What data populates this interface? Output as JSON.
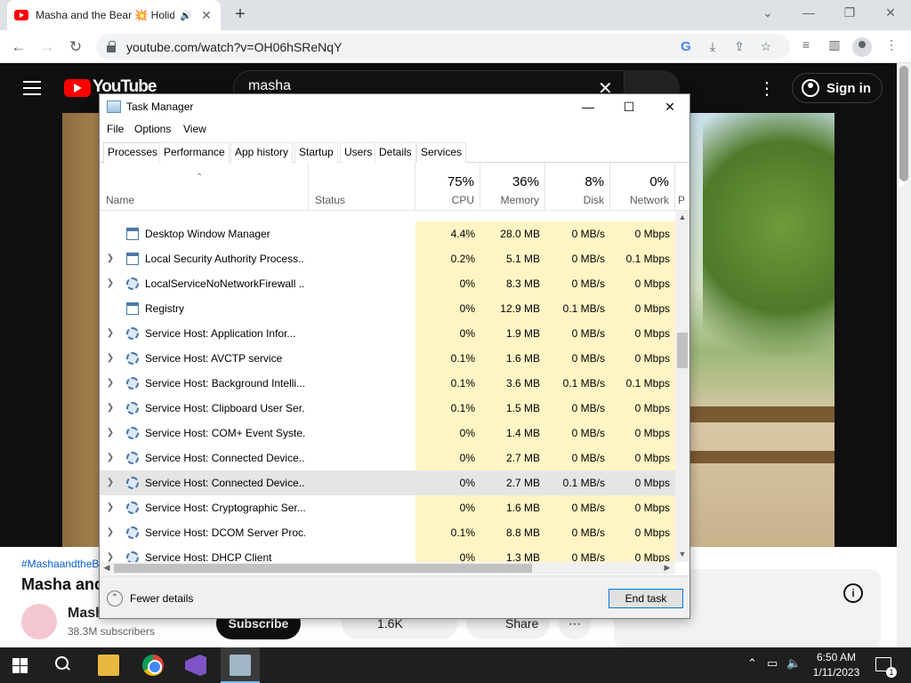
{
  "browser": {
    "tab_title": "Masha and the Bear 💥 Holiday on Ice",
    "url": "youtube.com/watch?v=OH06hSReNqY"
  },
  "youtube": {
    "logo_text": "YouTube",
    "search_value": "masha",
    "sign_in": "Sign in",
    "hashtag": "#MashaandtheBear",
    "video_title": "Masha and the Bear",
    "channel": "Masha and the Bear",
    "subscribers": "38.3M subscribers",
    "subscribe": "Subscribe",
    "likes": "1.6K",
    "share": "Share"
  },
  "task_manager": {
    "title": "Task Manager",
    "menus": [
      "File",
      "Options",
      "View"
    ],
    "tabs": [
      "Processes",
      "Performance",
      "App history",
      "Startup",
      "Users",
      "Details",
      "Services"
    ],
    "columns": {
      "name": "Name",
      "status": "Status",
      "cpu_pct": "75%",
      "cpu": "CPU",
      "mem_pct": "36%",
      "mem": "Memory",
      "disk_pct": "8%",
      "disk": "Disk",
      "net_pct": "0%",
      "net": "Network",
      "extra": "P"
    },
    "rows": [
      {
        "name": "Desktop Window Manager",
        "cpu": "4.4%",
        "mem": "28.0 MB",
        "disk": "0 MB/s",
        "net": "0 Mbps"
      },
      {
        "name": "Local Security Authority Process...",
        "cpu": "0.2%",
        "mem": "5.1 MB",
        "disk": "0 MB/s",
        "net": "0.1 Mbps"
      },
      {
        "name": "LocalServiceNoNetworkFirewall ...",
        "cpu": "0%",
        "mem": "8.3 MB",
        "disk": "0 MB/s",
        "net": "0 Mbps"
      },
      {
        "name": "Registry",
        "cpu": "0%",
        "mem": "12.9 MB",
        "disk": "0.1 MB/s",
        "net": "0 Mbps"
      },
      {
        "name": "Service Host: Application Infor...",
        "cpu": "0%",
        "mem": "1.9 MB",
        "disk": "0 MB/s",
        "net": "0 Mbps"
      },
      {
        "name": "Service Host: AVCTP service",
        "cpu": "0.1%",
        "mem": "1.6 MB",
        "disk": "0 MB/s",
        "net": "0 Mbps"
      },
      {
        "name": "Service Host: Background Intelli...",
        "cpu": "0.1%",
        "mem": "3.6 MB",
        "disk": "0.1 MB/s",
        "net": "0.1 Mbps"
      },
      {
        "name": "Service Host: Clipboard User Ser...",
        "cpu": "0.1%",
        "mem": "1.5 MB",
        "disk": "0 MB/s",
        "net": "0 Mbps"
      },
      {
        "name": "Service Host: COM+ Event Syste...",
        "cpu": "0%",
        "mem": "1.4 MB",
        "disk": "0 MB/s",
        "net": "0 Mbps"
      },
      {
        "name": "Service Host: Connected Device...",
        "cpu": "0%",
        "mem": "2.7 MB",
        "disk": "0 MB/s",
        "net": "0 Mbps"
      },
      {
        "name": "Service Host: Connected Device...",
        "cpu": "0%",
        "mem": "2.7 MB",
        "disk": "0.1 MB/s",
        "net": "0 Mbps"
      },
      {
        "name": "Service Host: Cryptographic Ser...",
        "cpu": "0%",
        "mem": "1.6 MB",
        "disk": "0 MB/s",
        "net": "0 Mbps"
      },
      {
        "name": "Service Host: DCOM Server Proc...",
        "cpu": "0.1%",
        "mem": "8.8 MB",
        "disk": "0 MB/s",
        "net": "0 Mbps"
      },
      {
        "name": "Service Host: DHCP Client",
        "cpu": "0%",
        "mem": "1.3 MB",
        "disk": "0 MB/s",
        "net": "0 Mbps"
      }
    ],
    "fewer_details": "Fewer details",
    "end_task": "End task"
  },
  "taskbar": {
    "time": "6:50 AM",
    "date": "1/11/2023",
    "notifications": "1"
  }
}
